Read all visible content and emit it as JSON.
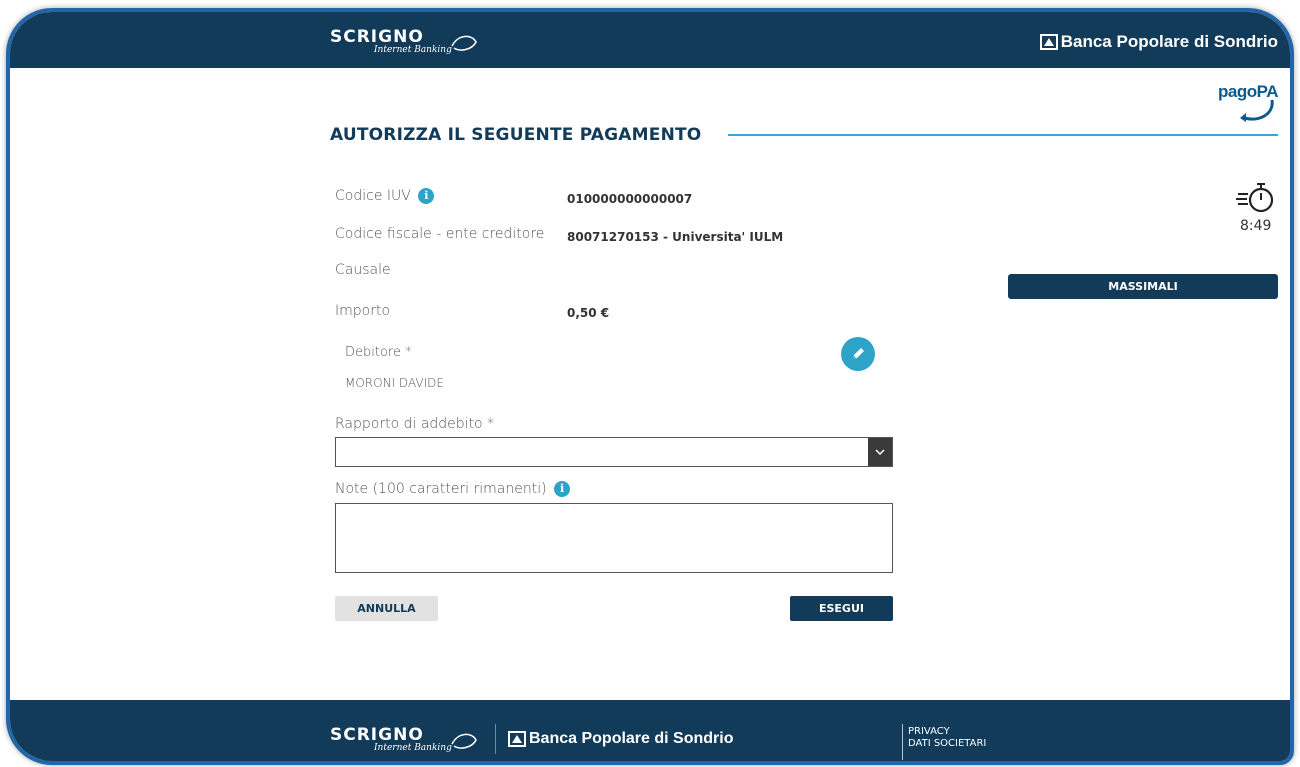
{
  "header": {
    "brand_word": "SCRIGNO",
    "brand_sub": "Internet Banking",
    "bank_name": "Banca Popolare di Sondrio"
  },
  "pagopa_logo": "pagoPA",
  "page_title": "AUTORIZZA IL SEGUENTE PAGAMENTO",
  "fields": {
    "iuv_label": "Codice IUV",
    "iuv_value": "010000000000007",
    "cf_label": "Codice fiscale - ente creditore",
    "cf_value": "80071270153 - Universita' IULM",
    "causale_label": "Causale",
    "importo_label": "Importo",
    "importo_value": "0,50 €",
    "debitore_label": "Debitore *",
    "debitore_value": "MORONI DAVIDE",
    "rapporto_label": "Rapporto di addebito *",
    "rapporto_value": "",
    "note_label": "Note (100 caratteri rimanenti)",
    "note_value": ""
  },
  "buttons": {
    "annulla": "ANNULLA",
    "esegui": "ESEGUI",
    "massimali": "MASSIMALI"
  },
  "timer": "8:49",
  "footer": {
    "brand_word": "SCRIGNO",
    "brand_sub": "Internet Banking",
    "bank_name": "Banca Popolare di Sondrio",
    "privacy": "PRIVACY",
    "dati": "DATI SOCIETARI"
  },
  "icons": {
    "info": "info-icon",
    "edit": "pencil-icon",
    "timer": "stopwatch-icon",
    "dropdown": "chevron-down-icon"
  },
  "colors": {
    "navy": "#123a59",
    "accent": "#2ea3c8",
    "frame": "#2366a8"
  }
}
